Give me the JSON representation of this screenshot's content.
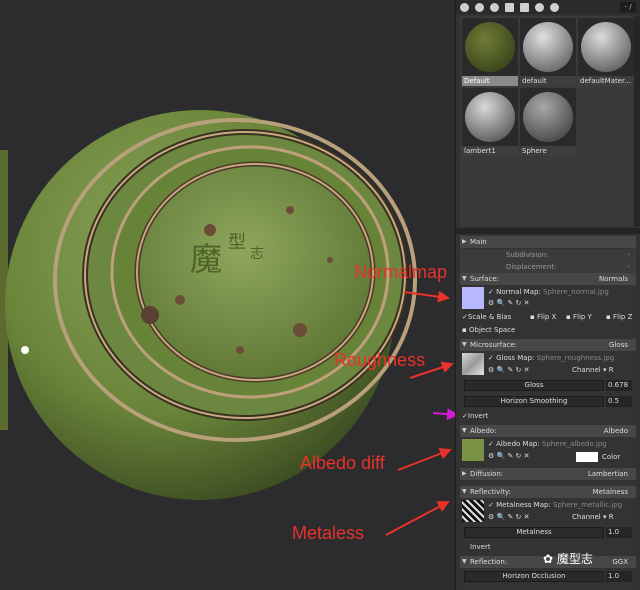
{
  "annotations": {
    "normalmap": "Normalmap",
    "roughness": "Roughness",
    "albedo": "Albedo diff",
    "metaless": "Metaless"
  },
  "toolbar": {
    "field": "- /"
  },
  "library": {
    "materials": [
      {
        "label": "Default",
        "selected": true,
        "color": "#4d5a22"
      },
      {
        "label": "default",
        "selected": false,
        "color": "#9a9a9a"
      },
      {
        "label": "defaultMater...",
        "selected": false,
        "color": "#8e8e8e"
      },
      {
        "label": "lambert1",
        "selected": false,
        "color": "#8a8a8a"
      },
      {
        "label": "Sphere",
        "selected": false,
        "color": "#6a6a6a"
      }
    ]
  },
  "props": {
    "main": "Main",
    "subdivision": "Subdivision:",
    "displacement": "Displacement:",
    "surface": {
      "label": "Surface:",
      "value": "Normals"
    },
    "normal_map": {
      "label": "Normal Map:",
      "file": "Sphere_normal.jpg"
    },
    "scale_bias": "Scale & Bias",
    "flip_x": "Flip X",
    "flip_y": "Flip Y",
    "flip_z": "Flip Z",
    "object_space": "Object Space",
    "microsurface": {
      "label": "Microsurface:",
      "value": "Gloss"
    },
    "gloss_map": {
      "label": "Gloss Map:",
      "file": "Sphere_roughness.jpg"
    },
    "channel_label": "Channel",
    "channel_r": "R",
    "gloss": {
      "label": "Gloss",
      "value": "0.678"
    },
    "horizon_smoothing": {
      "label": "Horizon Smoothing",
      "value": "0.5"
    },
    "invert": "Invert",
    "albedo": {
      "label": "Albedo:",
      "value": "Albedo"
    },
    "albedo_map": {
      "label": "Albedo Map:",
      "file": "Sphere_albedo.jpg"
    },
    "color": "Color",
    "diffusion": {
      "label": "Diffusion:",
      "value": "Lambertian"
    },
    "reflectivity": {
      "label": "Reflectivity:",
      "value": "Metalness"
    },
    "metalness_map": {
      "label": "Metalness Map:",
      "file": "Sphere_metallic.jpg"
    },
    "metalness": {
      "label": "Metalness",
      "value": "1.0"
    },
    "invert2": "Invert",
    "reflection": {
      "label": "Reflection:",
      "value": "GGX"
    },
    "horizon_occlusion": {
      "label": "Horizon Occlusion",
      "value": "1.0"
    }
  },
  "watermark": "魔型志",
  "colors": {
    "annotation_red": "#e8322a",
    "arrow_magenta": "#d61ad6",
    "sphere_green": "#6f8a3f",
    "normal_swatch": "#b7b7ff"
  }
}
